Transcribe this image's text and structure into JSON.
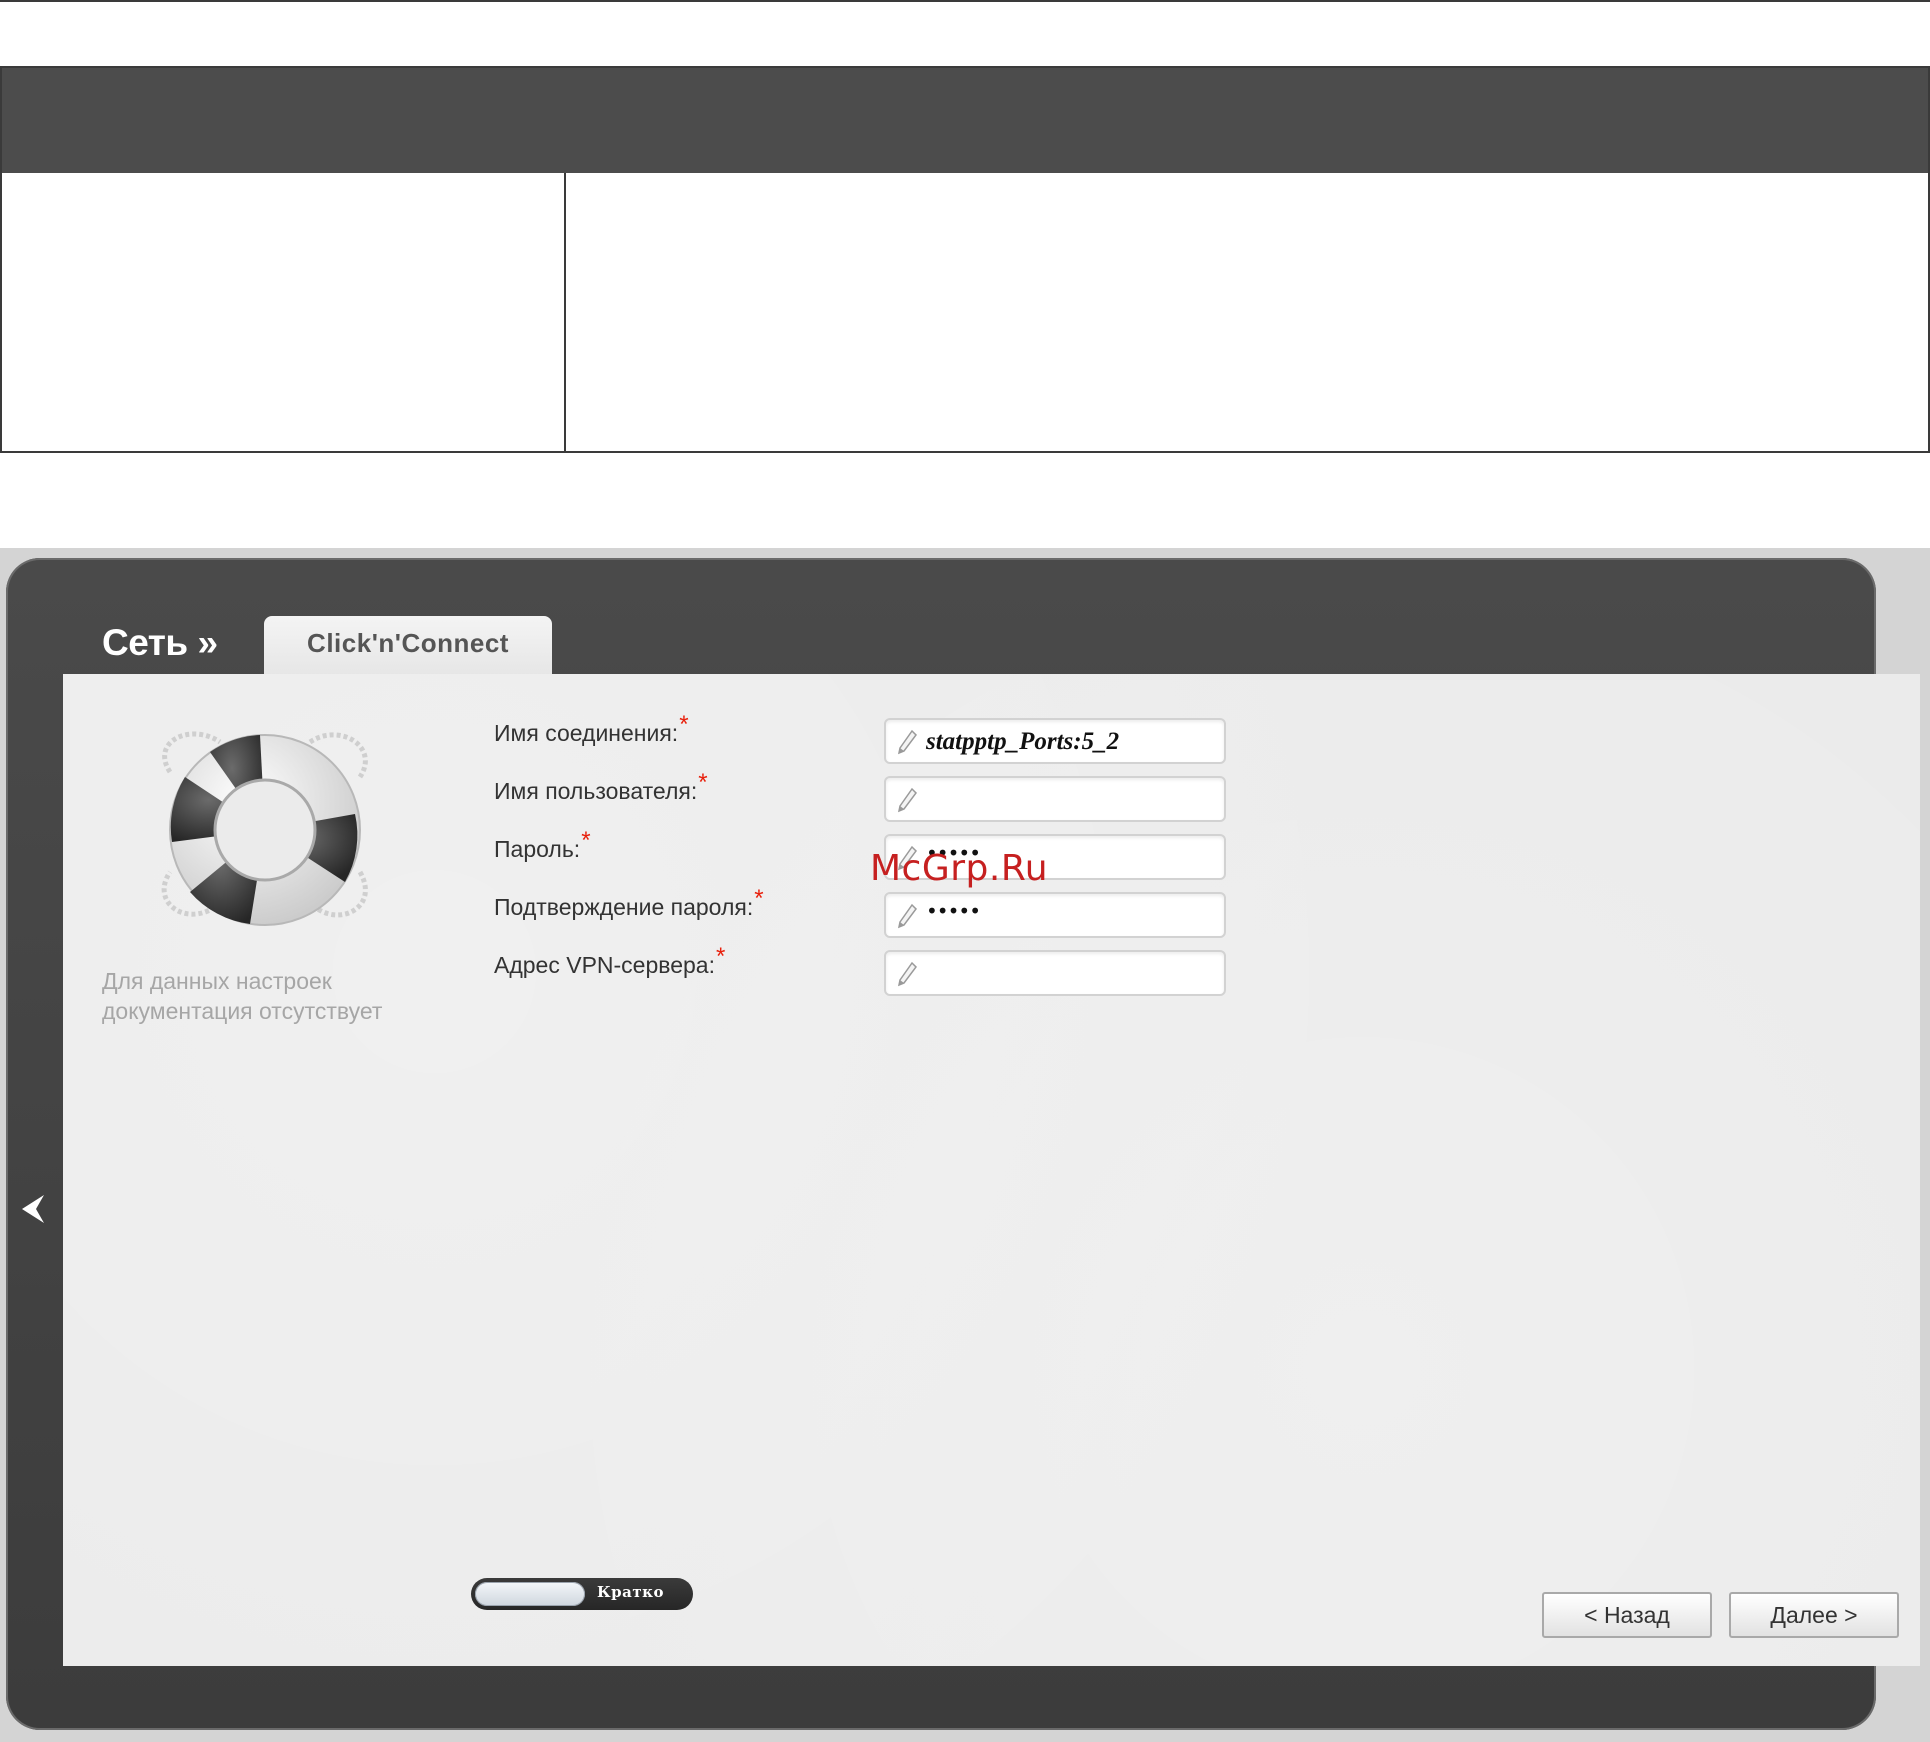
{
  "nav": {
    "breadcrumb": "Сеть »",
    "active_tab": "Click'n'Connect"
  },
  "help": {
    "icon": "lifebuoy-icon",
    "text": "Для данных настроек документация отсутствует"
  },
  "form": {
    "fields": [
      {
        "label": "Имя соединения:",
        "required_mark": "*",
        "value": "statpptp_Ports:5_2"
      },
      {
        "label": "Имя пользователя:",
        "required_mark": "*",
        "value": ""
      },
      {
        "label": "Пароль:",
        "required_mark": "*",
        "value": "•••••"
      },
      {
        "label": "Подтверждение пароля:",
        "required_mark": "*",
        "value": "•••••"
      },
      {
        "label": "Адрес VPN-сервера:",
        "required_mark": "*",
        "value": ""
      }
    ]
  },
  "controls": {
    "mode_toggle_label": "Кратко",
    "back_button": "< Назад",
    "next_button": "Далее >"
  },
  "watermark": "McGrp.Ru",
  "colors": {
    "frame": "#3c3c3c",
    "panel": "#ebebeb",
    "required": "#e8200c",
    "watermark": "#c62020"
  }
}
